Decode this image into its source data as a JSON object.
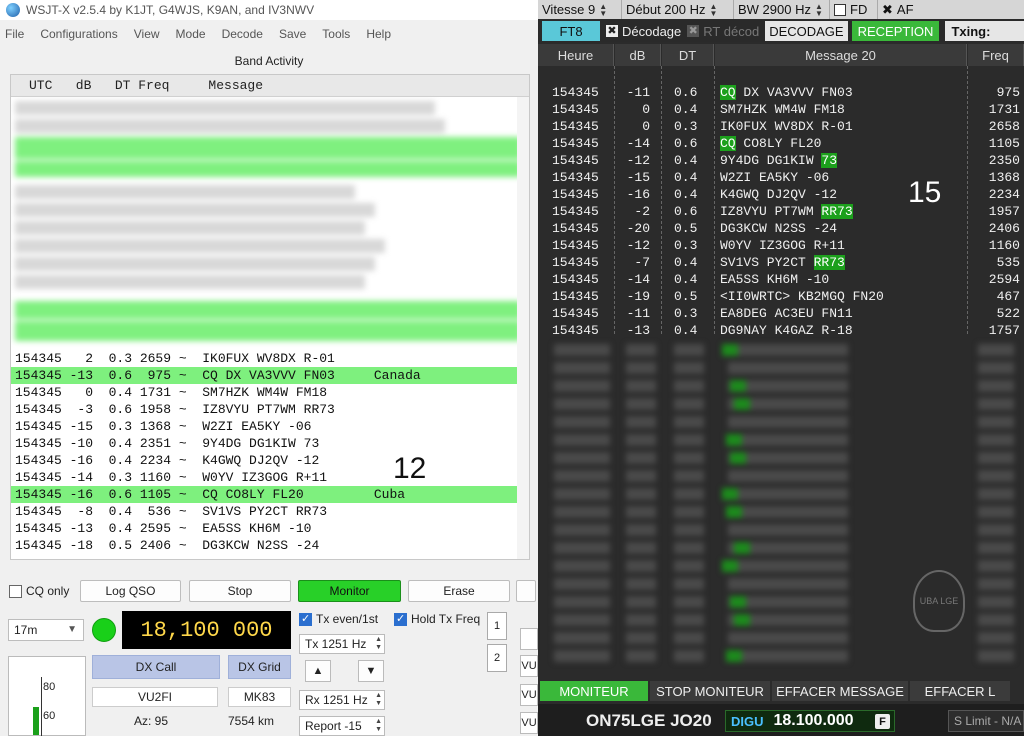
{
  "wsjtx": {
    "title": "WSJT-X   v2.5.4   by K1JT, G4WJS, K9AN, and IV3NWV",
    "menu": [
      "File",
      "Configurations",
      "View",
      "Mode",
      "Decode",
      "Save",
      "Tools",
      "Help"
    ],
    "band_activity_title": "Band Activity",
    "columns_header": "UTC   dB   DT Freq     Message",
    "decodes": [
      {
        "text": "154345   2  0.3 2659 ~  IK0FUX WV8DX R-01",
        "cq": false
      },
      {
        "text": "154345 -13  0.6  975 ~  CQ DX VA3VVV FN03     Canada",
        "cq": true
      },
      {
        "text": "154345   0  0.4 1731 ~  SM7HZK WM4W FM18",
        "cq": false
      },
      {
        "text": "154345  -3  0.6 1958 ~  IZ8VYU PT7WM RR73",
        "cq": false
      },
      {
        "text": "154345 -15  0.3 1368 ~  W2ZI EA5KY -06",
        "cq": false
      },
      {
        "text": "154345 -10  0.4 2351 ~  9Y4DG DG1KIW 73",
        "cq": false
      },
      {
        "text": "154345 -16  0.4 2234 ~  K4GWQ DJ2QV -12",
        "cq": false
      },
      {
        "text": "154345 -14  0.3 1160 ~  W0YV IZ3GOG R+11",
        "cq": false
      },
      {
        "text": "154345 -16  0.6 1105 ~  CQ CO8LY FL20         Cuba",
        "cq": true
      },
      {
        "text": "154345  -8  0.4  536 ~  SV1VS PY2CT RR73",
        "cq": false
      },
      {
        "text": "154345 -13  0.4 2595 ~  EA5SS KH6M -10",
        "cq": false
      },
      {
        "text": "154345 -18  0.5 2406 ~  DG3KCW N2SS -24",
        "cq": false
      }
    ],
    "overlay_number": "12",
    "cq_only_label": "CQ only",
    "log_qso_label": "Log QSO",
    "stop_label": "Stop",
    "monitor_label": "Monitor",
    "erase_label": "Erase",
    "band": "17m",
    "frequency": "18,100 000",
    "dx_call_label": "DX Call",
    "dx_grid_label": "DX Grid",
    "dx_call": "VU2FI",
    "dx_grid": "MK83",
    "az": "Az: 95",
    "distance": "7554 km",
    "tx_even_label": "Tx even/1st",
    "hold_tx_label": "Hold Tx Freq",
    "tx_freq": "Tx  1251  Hz",
    "rx_freq": "Rx  1251  Hz",
    "report": "Report -15",
    "tab1": "1",
    "tab2": "2",
    "vu_label": "VU",
    "meter_80": "80",
    "meter_60": "60",
    "meter_level": 0.35
  },
  "decoder": {
    "topbar": {
      "vitesse": "Vitesse 9",
      "debut": "Début 200 Hz",
      "bw": "BW 2900 Hz",
      "fd": "FD",
      "af": "AF"
    },
    "mode": "FT8",
    "decodage_label": "Décodage",
    "rt_label": "RT décod",
    "decodage_btn": "DECODAGE",
    "reception_btn": "RECEPTION",
    "txing": "Txing:",
    "headers": {
      "heure": "Heure",
      "db": "dB",
      "dt": "DT",
      "message": "Message 20",
      "freq": "Freq"
    },
    "rows": [
      {
        "heure": "154345",
        "db": "-11",
        "dt": "0.6",
        "pre": "CQ",
        "msg": " DX VA3VVV FN03",
        "post": "",
        "freq": "975"
      },
      {
        "heure": "154345",
        "db": "0",
        "dt": "0.4",
        "pre": "",
        "msg": "SM7HZK WM4W FM18",
        "post": "",
        "freq": "1731"
      },
      {
        "heure": "154345",
        "db": "0",
        "dt": "0.3",
        "pre": "",
        "msg": "IK0FUX WV8DX R-01",
        "post": "",
        "freq": "2658"
      },
      {
        "heure": "154345",
        "db": "-14",
        "dt": "0.6",
        "pre": "CQ",
        "msg": " CO8LY FL20",
        "post": "",
        "freq": "1105"
      },
      {
        "heure": "154345",
        "db": "-12",
        "dt": "0.4",
        "pre": "",
        "msg": "9Y4DG DG1KIW ",
        "post": "73",
        "freq": "2350"
      },
      {
        "heure": "154345",
        "db": "-15",
        "dt": "0.4",
        "pre": "",
        "msg": "W2ZI EA5KY -06",
        "post": "",
        "freq": "1368"
      },
      {
        "heure": "154345",
        "db": "-16",
        "dt": "0.4",
        "pre": "",
        "msg": "K4GWQ DJ2QV -12",
        "post": "",
        "freq": "2234"
      },
      {
        "heure": "154345",
        "db": "-2",
        "dt": "0.6",
        "pre": "",
        "msg": "IZ8VYU PT7WM ",
        "post": "RR73",
        "freq": "1957"
      },
      {
        "heure": "154345",
        "db": "-20",
        "dt": "0.5",
        "pre": "",
        "msg": "DG3KCW N2SS -24",
        "post": "",
        "freq": "2406"
      },
      {
        "heure": "154345",
        "db": "-12",
        "dt": "0.3",
        "pre": "",
        "msg": "W0YV IZ3GOG R+11",
        "post": "",
        "freq": "1160"
      },
      {
        "heure": "154345",
        "db": "-7",
        "dt": "0.4",
        "pre": "",
        "msg": "SV1VS PY2CT ",
        "post": "RR73",
        "freq": "535"
      },
      {
        "heure": "154345",
        "db": "-14",
        "dt": "0.4",
        "pre": "",
        "msg": "EA5SS KH6M -10",
        "post": "",
        "freq": "2594"
      },
      {
        "heure": "154345",
        "db": "-19",
        "dt": "0.5",
        "pre": "",
        "msg": "<II0WRTC> KB2MGQ FN20",
        "post": "",
        "freq": "467"
      },
      {
        "heure": "154345",
        "db": "-11",
        "dt": "0.3",
        "pre": "",
        "msg": "EA8DEG AC3EU FN11",
        "post": "",
        "freq": "522"
      },
      {
        "heure": "154345",
        "db": "-13",
        "dt": "0.4",
        "pre": "",
        "msg": "DG9NAY K4GAZ R-18",
        "post": "",
        "freq": "1757"
      }
    ],
    "overlay_number": "15",
    "logo_text": "UBA LGE",
    "bottom_buttons": [
      "MONITEUR",
      "STOP MONITEUR",
      "EFFACER MESSAGE",
      "EFFACER L"
    ],
    "callsign": "ON75LGE JO20",
    "digu": "DIGU",
    "frequency": "18.100.000",
    "f_badge": "F",
    "slimit": "S Limit - N/A"
  }
}
